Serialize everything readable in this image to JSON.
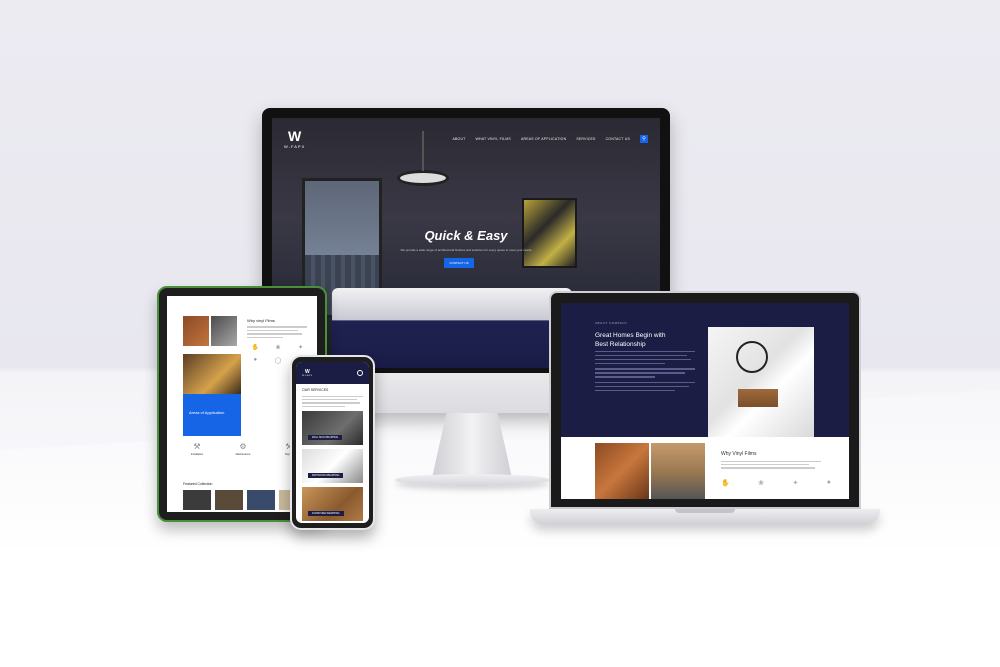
{
  "brand": {
    "logo_mark": "W",
    "logo_text": "W-FAPX"
  },
  "monitor": {
    "nav": [
      "ABOUT",
      "WHAT VINYL FILMS",
      "AREAS OF APPLICATION",
      "SERVICES",
      "CONTACT US"
    ],
    "search_icon": "search-icon",
    "hero_title": "Quick & Easy",
    "hero_subtitle": "We provide a wide range of architectural finishes and solutions for every space to meet your needs",
    "cta_label": "CONTACT US"
  },
  "tablet": {
    "section_title": "Why vinyl Films",
    "area_label": "Areas of Application",
    "services": [
      "Installation",
      "Maintenance",
      "Repair"
    ],
    "featured_title": "Featured Collection",
    "swatch_colors": [
      "#3b3b3b",
      "#5a4a3a",
      "#3a4a6a",
      "#c9b99a"
    ]
  },
  "phone": {
    "section_title": "OUR SERVICES",
    "cards": [
      "WALL SKIN WRAPPING",
      "BATHROOM WRAPPING",
      "FURNITURE WRAPPING"
    ]
  },
  "laptop": {
    "kicker": "ABOUT COMPANY",
    "headline_1": "Great Homes Begin with",
    "headline_2": "Best Relationship",
    "why_title": "Why Vinyl Films"
  },
  "colors": {
    "navy": "#1b1d45",
    "accent_blue": "#1565e6",
    "tablet_frame": "#4a8f3a"
  }
}
